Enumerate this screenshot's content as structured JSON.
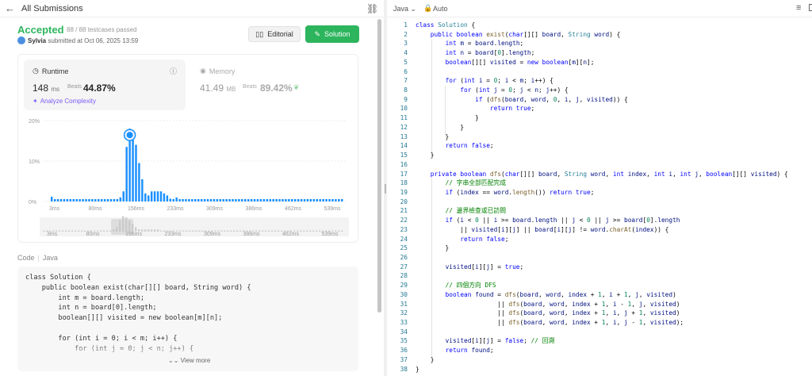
{
  "header": {
    "back_glyph": "←",
    "title": "All Submissions",
    "link_icon": "🔗"
  },
  "submission": {
    "status": "Accepted",
    "testcases": "88 / 88 testcases passed",
    "user": "Sylvia",
    "submitted_text": "submitted at Oct 06, 2025 13:59"
  },
  "buttons": {
    "editorial": "Editorial",
    "solution": "Solution"
  },
  "runtime": {
    "label": "Runtime",
    "value": "148",
    "unit": "ms",
    "beats_label": "Beats",
    "beats": "44.87%",
    "analyze": "Analyze Complexity"
  },
  "memory": {
    "label": "Memory",
    "value": "41.49",
    "unit": "MB",
    "beats_label": "Beats",
    "beats": "89.42%"
  },
  "chart_data": {
    "type": "bar",
    "y_ticks": [
      "20%",
      "10%",
      "0%"
    ],
    "ylim": [
      0,
      20
    ],
    "x_ticks": [
      "3ms",
      "80ms",
      "156ms",
      "233ms",
      "309ms",
      "386ms",
      "462ms",
      "539ms"
    ],
    "values": [
      1.2,
      0.6,
      0.6,
      0.6,
      0.6,
      0.6,
      0.6,
      0.6,
      0.6,
      0.6,
      0.6,
      0.6,
      0.6,
      0.6,
      0.6,
      0.6,
      0.6,
      0.6,
      0.6,
      0.6,
      0.6,
      0.6,
      1.0,
      2.5,
      13.5,
      18.0,
      17.0,
      14.0,
      9.5,
      5.5,
      2.0,
      1.5,
      2.5,
      2.5,
      2.5,
      2.5,
      2.0,
      1.5,
      0.7,
      0.6,
      1.0,
      0.6,
      0.6,
      0.6,
      0.6,
      0.6,
      0.6,
      0.6,
      0.6,
      0.6,
      0.6,
      0.6,
      0.6,
      0.6,
      0.6,
      0.6,
      0.6,
      0.6,
      0.6,
      0.6,
      0.6,
      0.6,
      0.6,
      0.6,
      0.6,
      0.6,
      0.6,
      0.6,
      0.6,
      0.6,
      0.6,
      0.6,
      0.6,
      0.6,
      0.6,
      0.6,
      0.6,
      0.6,
      0.6,
      0.6,
      0.6,
      0.6,
      0.6,
      0.6,
      0.6,
      0.6,
      0.6,
      0.6,
      0.6,
      0.6,
      0.6,
      0.6,
      0.6,
      0.6
    ],
    "highlight_index": 25,
    "bar_color": "#1a90ff",
    "overview_values": [
      1,
      1,
      1,
      1,
      1,
      1,
      1,
      1,
      1,
      1,
      1,
      1,
      1,
      1,
      1,
      1,
      1,
      1,
      1,
      1,
      1,
      1,
      2,
      4,
      10,
      14,
      13,
      10,
      7,
      4,
      2,
      2,
      2,
      2,
      2,
      2,
      2,
      1,
      1,
      1,
      1,
      1,
      1,
      1,
      1,
      1,
      1,
      1,
      1,
      1,
      1,
      1,
      1,
      1,
      1,
      1,
      1,
      1,
      1,
      1,
      1,
      1,
      1,
      1,
      1,
      1,
      1,
      1,
      1,
      1,
      1,
      1,
      1,
      1,
      1,
      1,
      1,
      1,
      1,
      1,
      1,
      1,
      1,
      1,
      1,
      1,
      1,
      1,
      1,
      1,
      1,
      1,
      1,
      1,
      1
    ]
  },
  "code_preview": {
    "label": "Code",
    "lang": "Java",
    "lines": [
      "class Solution {",
      "    public boolean exist(char[][] board, String word) {",
      "        int m = board.length;",
      "        int n = board[0].length;",
      "        boolean[][] visited = new boolean[m][n];",
      "",
      "        for (int i = 0; i < m; i++) {",
      "            for (int j = 0; j < n; j++) {"
    ],
    "view_more": "View more"
  },
  "editor": {
    "language": "Java",
    "mode": "Auto",
    "line_numbers": [
      "1",
      "2",
      "3",
      "4",
      "5",
      "6",
      "7",
      "8",
      "9",
      "10",
      "11",
      "12",
      "13",
      "14",
      "15",
      "16",
      "17",
      "18",
      "19",
      "20",
      "21",
      "22",
      "23",
      "24",
      "25",
      "26",
      "27",
      "28",
      "29",
      "30",
      "31",
      "32",
      "33",
      "34",
      "35",
      "36",
      "37",
      "38"
    ]
  }
}
